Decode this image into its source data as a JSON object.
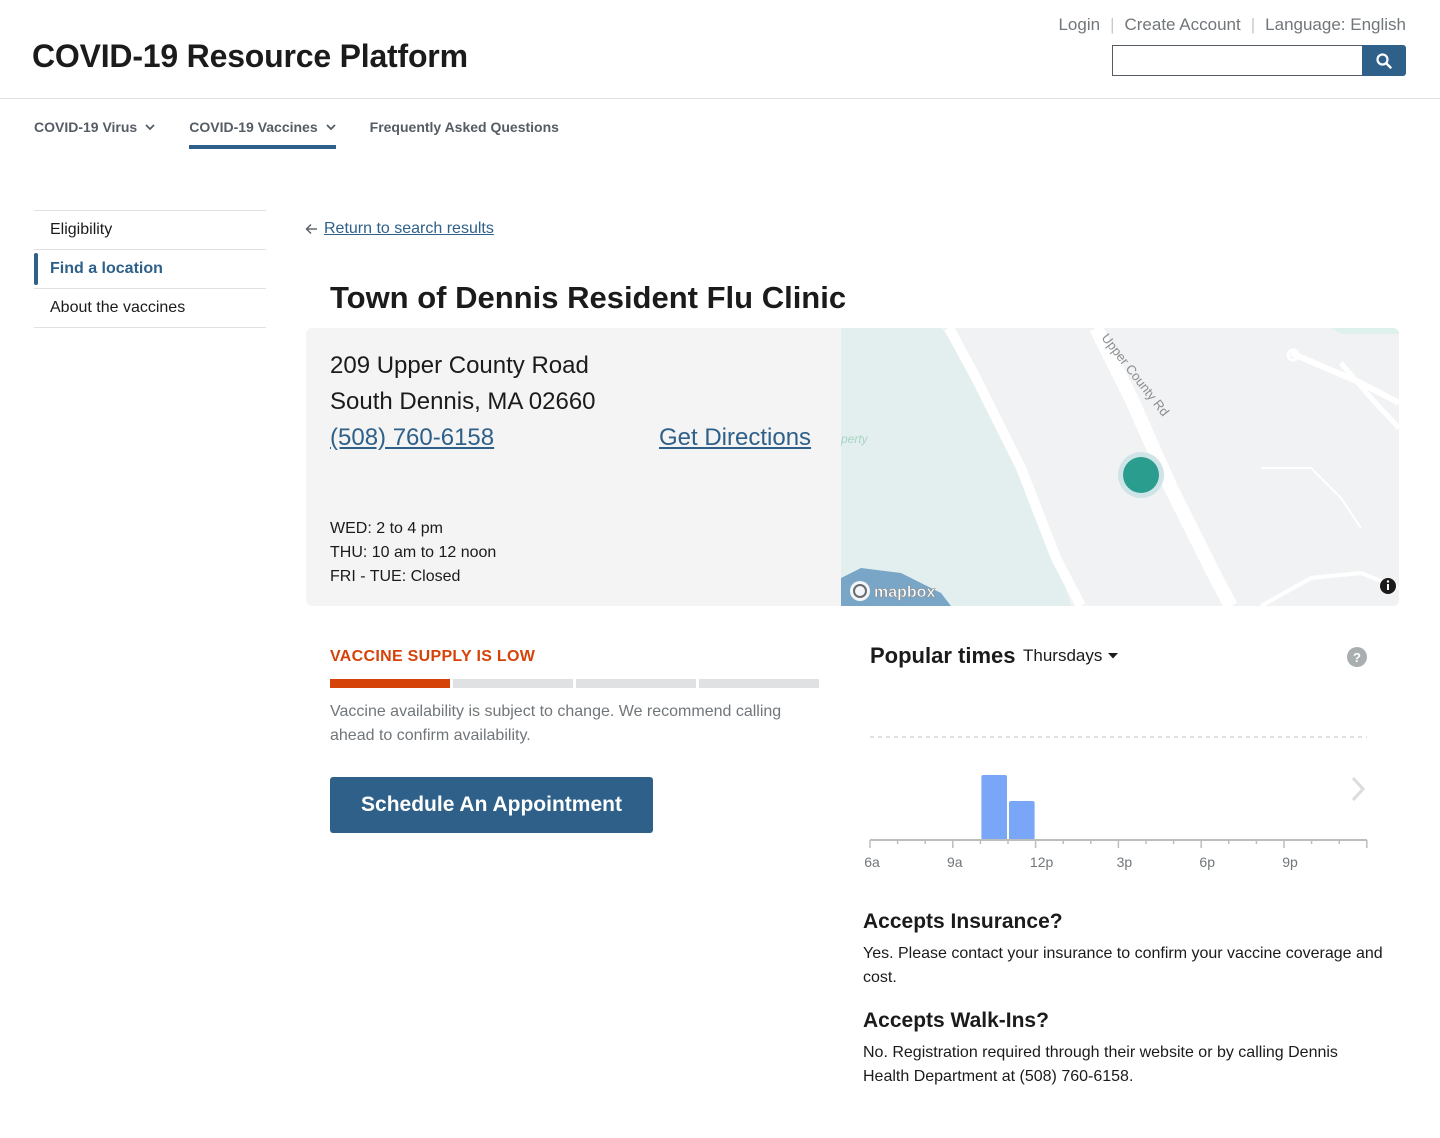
{
  "header": {
    "site_title": "COVID-19 Resource Platform",
    "links": {
      "login": "Login",
      "create_account": "Create Account",
      "language": "Language: English"
    },
    "search": {
      "value": "",
      "placeholder": ""
    }
  },
  "nav": {
    "items": [
      {
        "label": "COVID-19 Virus",
        "has_dropdown": true,
        "active": false
      },
      {
        "label": "COVID-19 Vaccines",
        "has_dropdown": true,
        "active": true
      },
      {
        "label": "Frequently Asked Questions",
        "has_dropdown": false,
        "active": false
      }
    ]
  },
  "sidenav": {
    "items": [
      {
        "label": "Eligibility",
        "current": false
      },
      {
        "label": "Find a location",
        "current": true
      },
      {
        "label": "About the vaccines",
        "current": false
      }
    ]
  },
  "main": {
    "back_link": "Return to search results",
    "title": "Town of Dennis Resident Flu Clinic",
    "location": {
      "address_line1": "209 Upper County Road",
      "address_line2": "South Dennis, MA 02660",
      "phone": "(508) 760-6158",
      "directions_label": "Get Directions",
      "hours": [
        "WED: 2 to 4 pm",
        "THU: 10 am to 12 noon",
        "FRI - TUE: Closed"
      ]
    },
    "map": {
      "road_label": "Upper County Rd",
      "attribution": "mapbox",
      "faint_label": "perty",
      "marker_color": "#2a9d8f"
    },
    "supply": {
      "label": "VACCINE SUPPLY IS LOW",
      "level_segments": 1,
      "total_segments": 4,
      "color": "#d54309",
      "note": "Vaccine availability is subject to change. We recommend calling ahead to confirm availability."
    },
    "schedule_button": "Schedule An Appointment",
    "popular_times": {
      "title": "Popular times",
      "day": "Thursdays",
      "help": "?"
    },
    "insurance": {
      "heading": "Accepts Insurance?",
      "text": "Yes. Please contact your insurance to confirm your vaccine coverage and cost."
    },
    "walk_ins": {
      "heading": "Accepts Walk-Ins?",
      "text": "No. Registration required through their website or by calling Dennis Health Department at (508) 760-6158."
    }
  },
  "chart_data": {
    "type": "bar",
    "title": "Popular times",
    "x_tick_labels": [
      "6a",
      "9a",
      "12p",
      "3p",
      "6p",
      "9p"
    ],
    "hours": [
      6,
      7,
      8,
      9,
      10,
      11,
      12,
      13,
      14,
      15,
      16,
      17,
      18,
      19,
      20,
      21,
      22,
      23
    ],
    "values": [
      0,
      0,
      0,
      0,
      100,
      60,
      0,
      0,
      0,
      0,
      0,
      0,
      0,
      0,
      0,
      0,
      0,
      0
    ],
    "ylim": [
      0,
      100
    ],
    "bar_color": "#7aa6f7"
  }
}
